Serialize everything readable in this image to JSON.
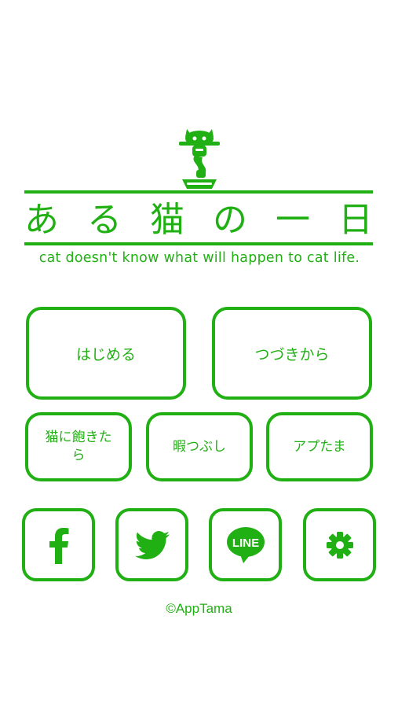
{
  "title_chars": [
    "あ",
    "る",
    "猫",
    "の",
    "一",
    "日"
  ],
  "subtitle": "cat doesn't know what will happen to cat life.",
  "menu": {
    "start_label": "はじめる",
    "continue_label": "つづきから",
    "bored_label": "猫に飽きたら",
    "pastime_label": "暇つぶし",
    "apptama_label": "アプたま"
  },
  "social": {
    "facebook_icon": "facebook-icon",
    "twitter_icon": "twitter-icon",
    "line_icon": "line-icon",
    "line_label": "LINE",
    "settings_icon": "gear-icon"
  },
  "copyright": "©AppTama",
  "colors": {
    "accent": "#21b014",
    "background": "#ffffff"
  }
}
